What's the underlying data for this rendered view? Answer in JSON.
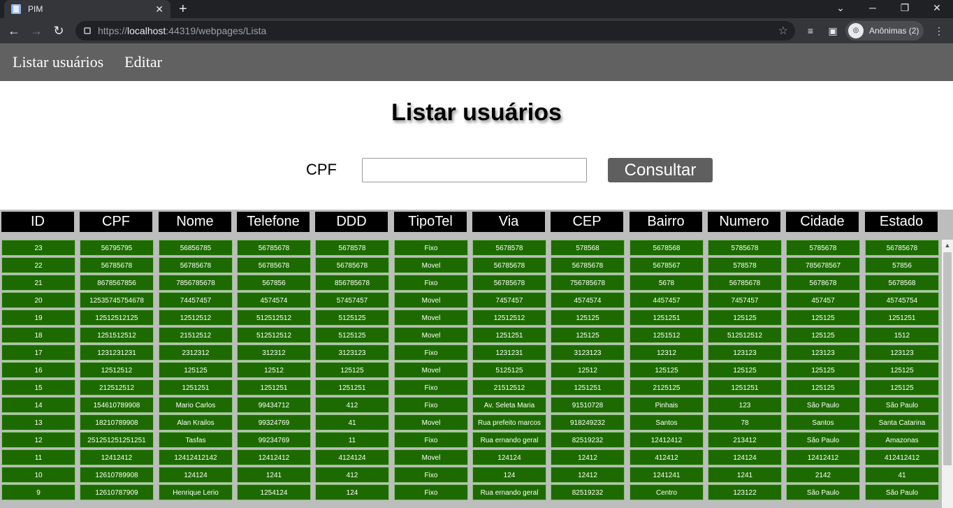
{
  "browser": {
    "tab_title": "PIM",
    "tab_close": "✕",
    "new_tab": "+",
    "url_prefix": "https://",
    "url_host": "localhost",
    "url_rest": ":44319/webpages/Lista",
    "profile_label": "Anônimas (2)"
  },
  "nav": {
    "items": [
      "Listar usuários",
      "Editar"
    ]
  },
  "page": {
    "title": "Listar usuários",
    "cpf_label": "CPF",
    "cpf_value": "",
    "consultar_label": "Consultar"
  },
  "table": {
    "columns": [
      "ID",
      "CPF",
      "Nome",
      "Telefone",
      "DDD",
      "TipoTel",
      "Via",
      "CEP",
      "Bairro",
      "Numero",
      "Cidade",
      "Estado"
    ],
    "rows": [
      [
        "23",
        "56795795",
        "56856785",
        "56785678",
        "5678578",
        "Fixo",
        "5678578",
        "578568",
        "5678568",
        "5785678",
        "5785678",
        "56785678"
      ],
      [
        "22",
        "56785678",
        "56785678",
        "56785678",
        "56785678",
        "Movel",
        "56785678",
        "56785678",
        "5678567",
        "578578",
        "785678567",
        "57856"
      ],
      [
        "21",
        "8678567856",
        "7856785678",
        "567856",
        "856785678",
        "Fixo",
        "56785678",
        "756785678",
        "5678",
        "56785678",
        "5678678",
        "5678568"
      ],
      [
        "20",
        "12535745754678",
        "74457457",
        "4574574",
        "57457457",
        "Movel",
        "7457457",
        "4574574",
        "4457457",
        "7457457",
        "457457",
        "45745754"
      ],
      [
        "19",
        "12512512125",
        "12512512",
        "512512512",
        "5125125",
        "Movel",
        "12512512",
        "125125",
        "1251251",
        "125125",
        "125125",
        "1251251"
      ],
      [
        "18",
        "1251512512",
        "21512512",
        "512512512",
        "5125125",
        "Movel",
        "1251251",
        "125125",
        "1251512",
        "512512512",
        "125125",
        "1512"
      ],
      [
        "17",
        "1231231231",
        "2312312",
        "312312",
        "3123123",
        "Fixo",
        "1231231",
        "3123123",
        "12312",
        "123123",
        "123123",
        "123123"
      ],
      [
        "16",
        "12512512",
        "125125",
        "12512",
        "125125",
        "Movel",
        "5125125",
        "12512",
        "125125",
        "125125",
        "125125",
        "125125"
      ],
      [
        "15",
        "212512512",
        "1251251",
        "1251251",
        "1251251",
        "Fixo",
        "21512512",
        "1251251",
        "2125125",
        "1251251",
        "125125",
        "125125"
      ],
      [
        "14",
        "154610789908",
        "Mario Carlos",
        "99434712",
        "412",
        "Fixo",
        "Av. Seleta Maria",
        "91510728",
        "Pinhais",
        "123",
        "São Paulo",
        "São Paulo"
      ],
      [
        "13",
        "18210789908",
        "Alan Krailos",
        "99324769",
        "41",
        "Movel",
        "Rua prefeito marcos",
        "918249232",
        "Santos",
        "78",
        "Santos",
        "Santa Catarina"
      ],
      [
        "12",
        "251251251251251",
        "Tasfas",
        "99234769",
        "11",
        "Fixo",
        "Rua ernando geral",
        "82519232",
        "12412412",
        "213412",
        "São Paulo",
        "Amazonas"
      ],
      [
        "11",
        "12412412",
        "12412412142",
        "12412412",
        "4124124",
        "Movel",
        "124124",
        "12412",
        "412412",
        "124124",
        "12412412",
        "412412412"
      ],
      [
        "10",
        "12610789908",
        "124124",
        "1241",
        "412",
        "Fixo",
        "124",
        "12412",
        "1241241",
        "1241",
        "2142",
        "41"
      ],
      [
        "9",
        "12610787909",
        "Henrique Lerio",
        "1254124",
        "124",
        "Fixo",
        "Rua ernando geral",
        "82519232",
        "Centro",
        "123122",
        "São Paulo",
        "São Paulo"
      ]
    ]
  },
  "colors": {
    "nav_bg": "#616161",
    "header_cell_bg": "#000000",
    "cell_bg": "#1d6b00",
    "table_bg": "#bdbdbd",
    "button_bg": "#5f5f5f"
  }
}
